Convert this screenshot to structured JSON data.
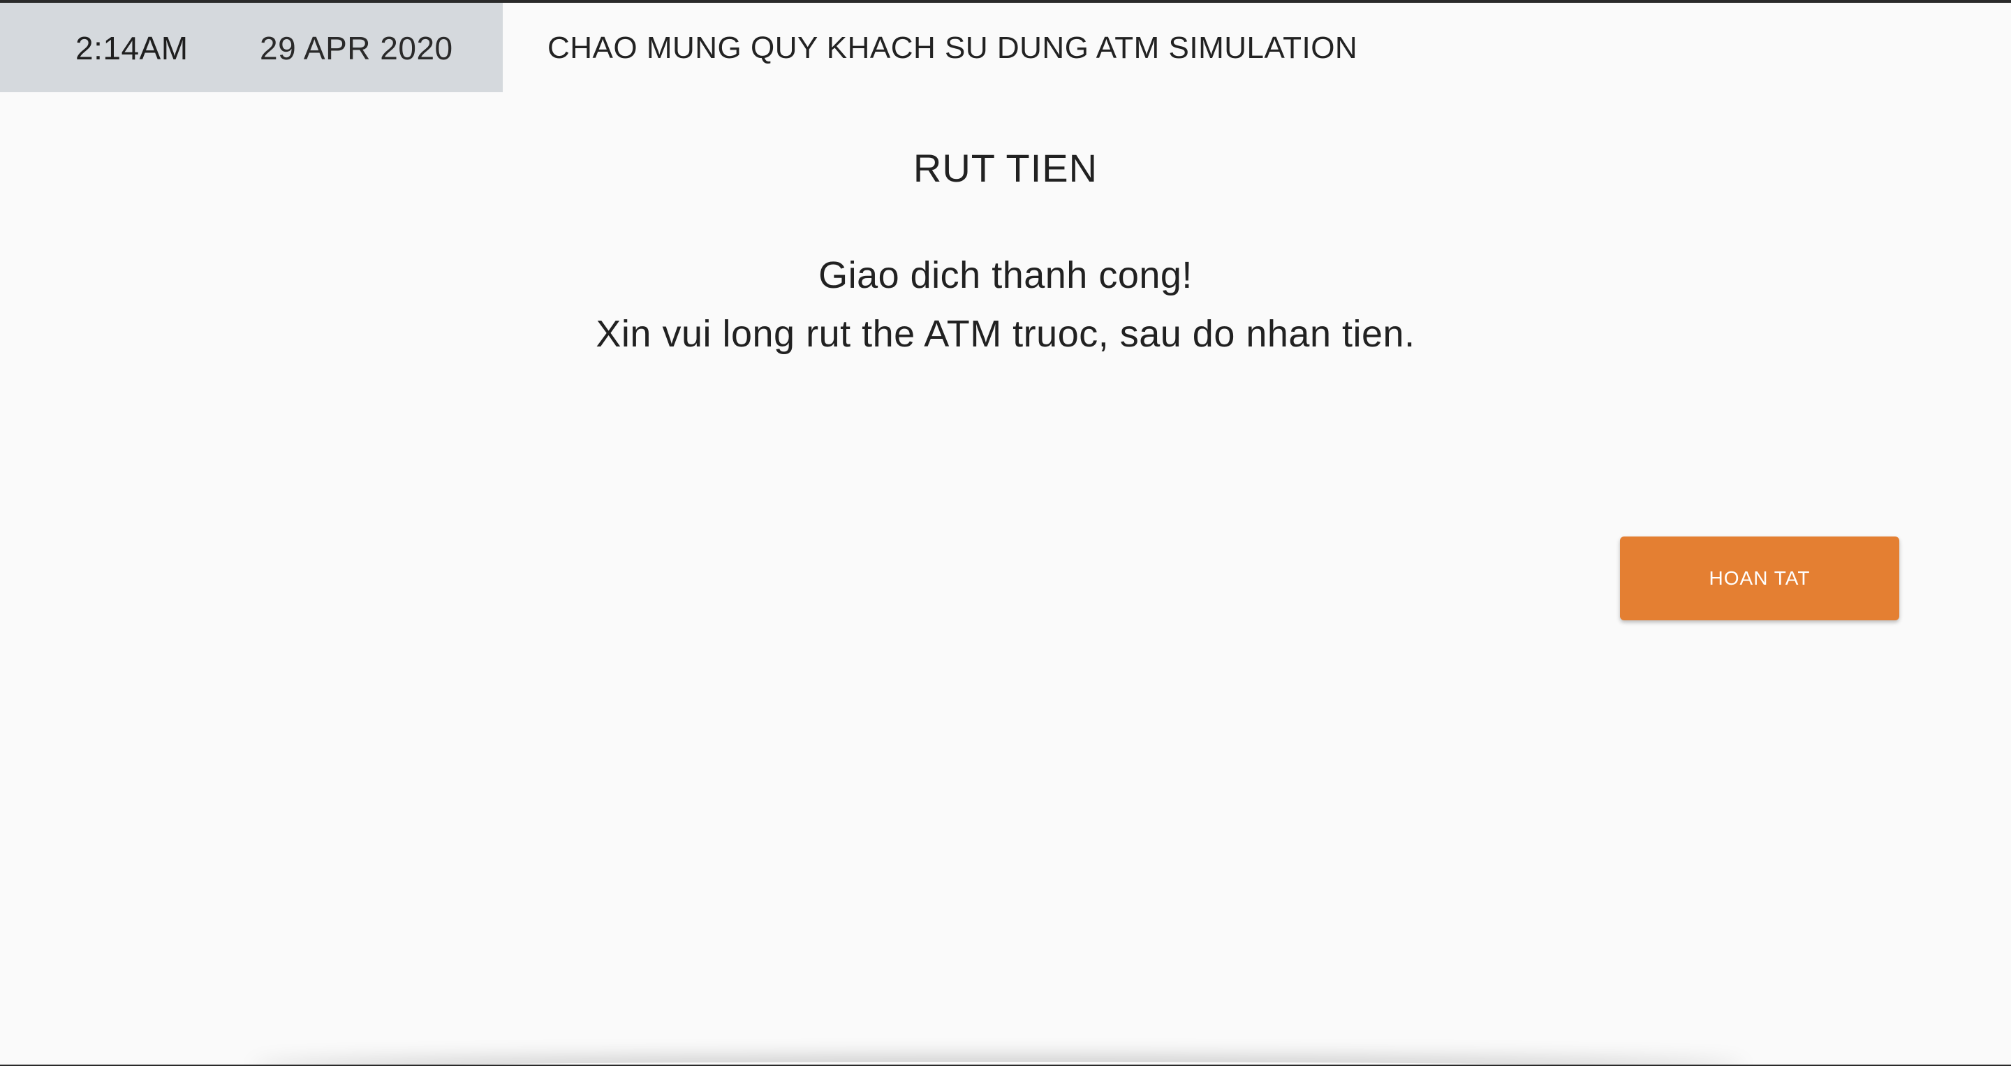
{
  "header": {
    "time": "2:14AM",
    "date": "29 APR 2020",
    "welcome": "CHAO MUNG QUY KHACH SU DUNG ATM SIMULATION"
  },
  "main": {
    "title": "RUT TIEN",
    "message_line1": "Giao dich thanh cong!",
    "message_line2": "Xin vui long rut the ATM truoc, sau do nhan tien."
  },
  "actions": {
    "done_label": "HOAN TAT"
  },
  "colors": {
    "accent": "#e47f32",
    "header_panel": "#d5d9dd",
    "background": "#fafafa"
  }
}
